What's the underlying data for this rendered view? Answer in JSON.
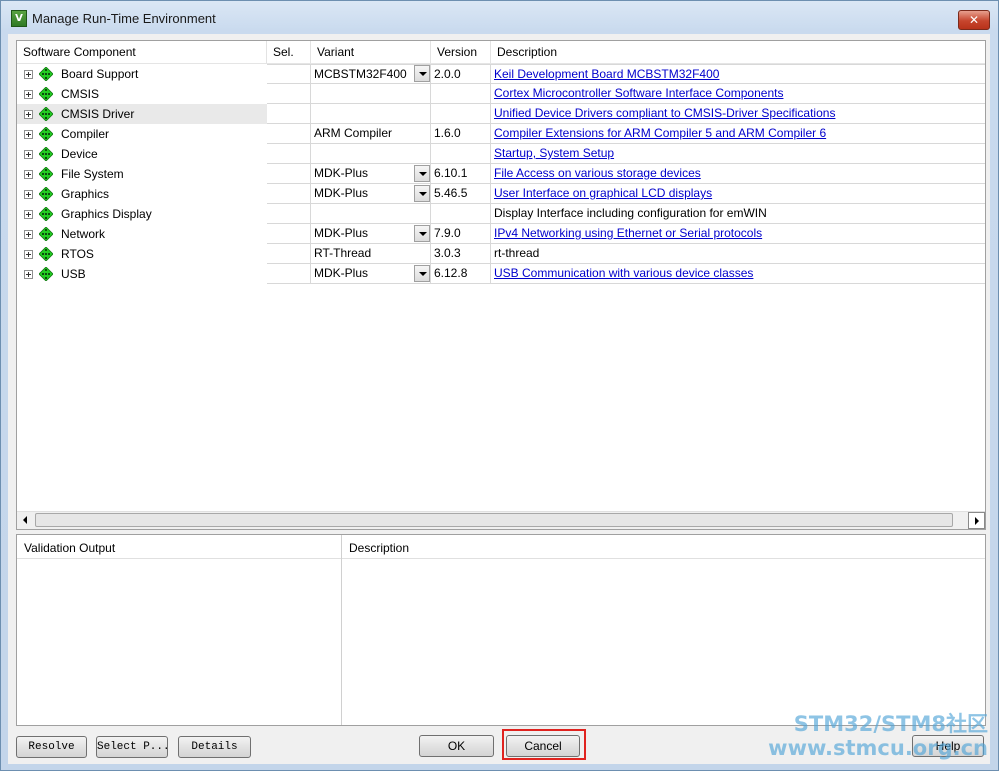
{
  "window": {
    "title": "Manage Run-Time Environment",
    "icon_letter": "V",
    "close_symbol": "✕"
  },
  "grid": {
    "headers": {
      "component": "Software Component",
      "sel": "Sel.",
      "variant": "Variant",
      "version": "Version",
      "description": "Description"
    },
    "rows": [
      {
        "name": "Board Support",
        "variant": "MCBSTM32F400",
        "has_dropdown": true,
        "version": "2.0.0",
        "description": "Keil Development Board MCBSTM32F400",
        "link": true
      },
      {
        "name": "CMSIS",
        "variant": "",
        "has_dropdown": false,
        "version": "",
        "description": "Cortex Microcontroller Software Interface Components",
        "link": true
      },
      {
        "name": "CMSIS Driver",
        "variant": "",
        "has_dropdown": false,
        "version": "",
        "description": "Unified Device Drivers compliant to CMSIS-Driver Specifications",
        "link": true,
        "selected": true
      },
      {
        "name": "Compiler",
        "variant": "ARM Compiler",
        "has_dropdown": false,
        "version": "1.6.0",
        "description": "Compiler Extensions for ARM Compiler 5 and ARM Compiler 6",
        "link": true
      },
      {
        "name": "Device",
        "variant": "",
        "has_dropdown": false,
        "version": "",
        "description": "Startup, System Setup",
        "link": true
      },
      {
        "name": "File System",
        "variant": "MDK-Plus",
        "has_dropdown": true,
        "version": "6.10.1",
        "description": "File Access on various storage devices",
        "link": true
      },
      {
        "name": "Graphics",
        "variant": "MDK-Plus",
        "has_dropdown": true,
        "version": "5.46.5",
        "description": "User Interface on graphical LCD displays",
        "link": true
      },
      {
        "name": "Graphics Display",
        "variant": "",
        "has_dropdown": false,
        "version": "",
        "description": "Display Interface including configuration for emWIN",
        "link": false
      },
      {
        "name": "Network",
        "variant": "MDK-Plus",
        "has_dropdown": true,
        "version": "7.9.0",
        "description": "IPv4 Networking using Ethernet or Serial protocols",
        "link": true
      },
      {
        "name": "RTOS",
        "variant": "RT-Thread",
        "has_dropdown": false,
        "version": "3.0.3",
        "description": "rt-thread",
        "link": false
      },
      {
        "name": "USB",
        "variant": "MDK-Plus",
        "has_dropdown": true,
        "version": "6.12.8",
        "description": "USB Communication with various device classes",
        "link": true
      }
    ]
  },
  "validation": {
    "output_header": "Validation Output",
    "description_header": "Description"
  },
  "buttons": {
    "resolve": "Resolve",
    "select_packs": "Select P...",
    "details": "Details",
    "ok": "OK",
    "cancel": "Cancel",
    "help": "Help"
  },
  "watermark": {
    "line1": "STM32/STM8社区",
    "line2": "www.stmcu.org.cn"
  },
  "colors": {
    "link": "#0000cc",
    "highlight": "#e0231f",
    "component_icon": "#22cc22"
  }
}
